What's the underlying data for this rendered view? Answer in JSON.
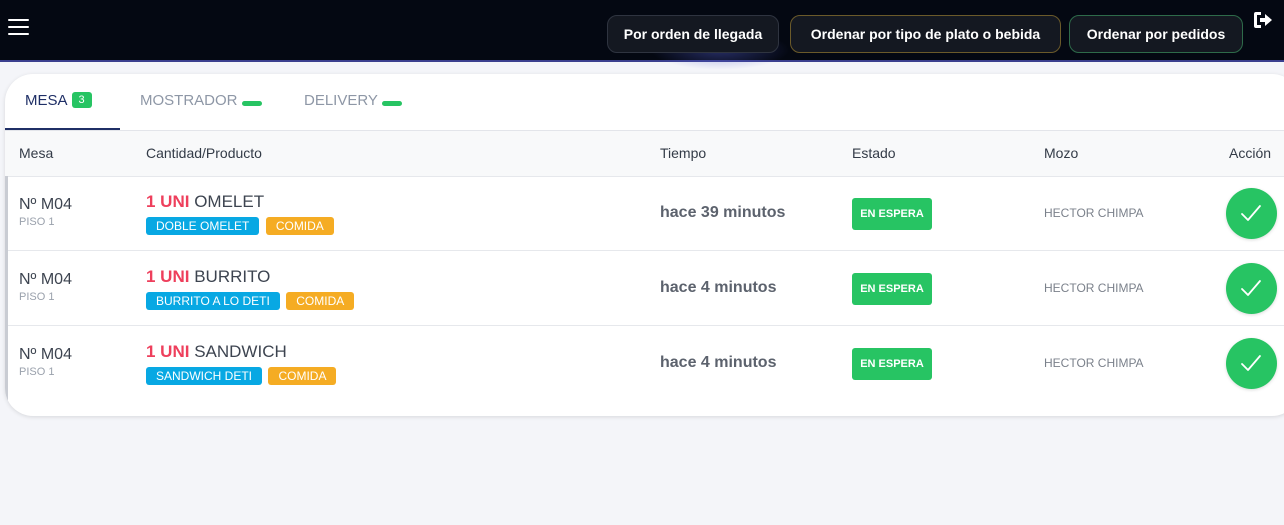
{
  "topbar": {
    "sort_buttons": [
      {
        "label": "Por orden de llegada"
      },
      {
        "label": "Ordenar por tipo de plato o bebida"
      },
      {
        "label": "Ordenar por pedidos"
      }
    ],
    "menu_icon": "hamburger-menu-icon",
    "logout_icon": "logout-icon"
  },
  "tabs": [
    {
      "label": "MESA",
      "badge": "3",
      "active": true
    },
    {
      "label": "MOSTRADOR",
      "badge": "",
      "active": false
    },
    {
      "label": "DELIVERY",
      "badge": "",
      "active": false
    }
  ],
  "table": {
    "headers": [
      "Mesa",
      "Cantidad/Producto",
      "Tiempo",
      "Estado",
      "Mozo",
      "Acción"
    ],
    "rows": [
      {
        "mesa": "Nº M04",
        "piso": "PISO 1",
        "cantidad": "1 UNI",
        "producto": "OMELET",
        "tags": [
          "DOBLE OMELET",
          "COMIDA"
        ],
        "tiempo": "hace 39 minutos",
        "estado": "EN ESPERA",
        "mozo": "HECTOR CHIMPA"
      },
      {
        "mesa": "Nº M04",
        "piso": "PISO 1",
        "cantidad": "1 UNI",
        "producto": "BURRITO",
        "tags": [
          "BURRITO A LO DETI",
          "COMIDA"
        ],
        "tiempo": "hace 4 minutos",
        "estado": "EN ESPERA",
        "mozo": "HECTOR CHIMPA"
      },
      {
        "mesa": "Nº M04",
        "piso": "PISO 1",
        "cantidad": "1 UNI",
        "producto": "SANDWICH",
        "tags": [
          "SANDWICH DETI",
          "COMIDA"
        ],
        "tiempo": "hace 4 minutos",
        "estado": "EN ESPERA",
        "mozo": "HECTOR CHIMPA"
      }
    ]
  },
  "colors": {
    "topbar_bg": "#040812",
    "accent_green": "#27c463",
    "qty_red": "#ee3f5c",
    "tag_blue": "#08a8e3",
    "tag_orange": "#f5ac23",
    "active_tab": "#1f2f66"
  },
  "action_icon": "check-icon"
}
